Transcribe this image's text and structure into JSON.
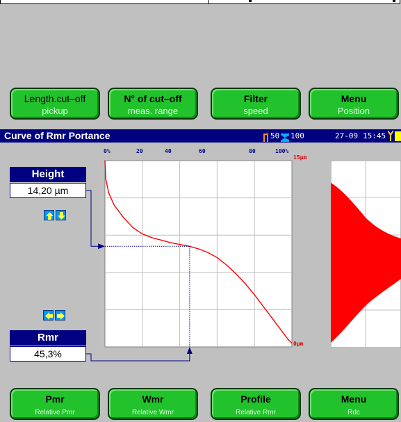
{
  "top_buttons": [
    {
      "label": "Length.cut–off",
      "sub": "pickup"
    },
    {
      "label": "N° of cut–off",
      "sub": "meas. range"
    },
    {
      "label": "Filter",
      "sub": "speed"
    },
    {
      "label": "Menu",
      "sub": "Position"
    }
  ],
  "title_bar": {
    "title": "Curve of Rmr Portance",
    "count_a": "50",
    "count_b": "100",
    "date": "27-09",
    "time": "15:45"
  },
  "height_panel": {
    "label": "Height",
    "value": "14,20 µm"
  },
  "rmr_panel": {
    "label": "Rmr",
    "value": "45,3%"
  },
  "chart_data": {
    "type": "line",
    "x_ticks": [
      "0%",
      "20",
      "40",
      "60",
      "80",
      "100%"
    ],
    "y_top_label": "15µm",
    "y_bottom_label": "0µm",
    "xlim": [
      0,
      100
    ],
    "ylim": [
      0,
      15
    ],
    "grid": true,
    "series_color": "#ff0000",
    "x": [
      0,
      0.5,
      2,
      5,
      10,
      15,
      20,
      25,
      30,
      35,
      40,
      45.3,
      50,
      55,
      60,
      65,
      70,
      75,
      80,
      85,
      90,
      95,
      98,
      100
    ],
    "y": [
      15,
      13.5,
      12.4,
      11.4,
      10.4,
      9.6,
      9.1,
      8.8,
      8.6,
      8.4,
      8.25,
      8.1,
      7.9,
      7.6,
      7.2,
      6.6,
      5.9,
      5.1,
      4.2,
      3.2,
      2.2,
      1.2,
      0.6,
      0.3
    ],
    "cursor": {
      "x": 45.3,
      "y": 8.1,
      "color": "#000080"
    }
  },
  "amplitude_distribution": {
    "color": "#ff0000"
  },
  "bottom_buttons": [
    {
      "label": "Pmr",
      "sub": "Relative Pmr"
    },
    {
      "label": "Wmr",
      "sub": "Relative Wmr"
    },
    {
      "label": "Profile",
      "sub": "Relative Rmr"
    },
    {
      "label": "Menu",
      "sub": "Rdc"
    }
  ]
}
